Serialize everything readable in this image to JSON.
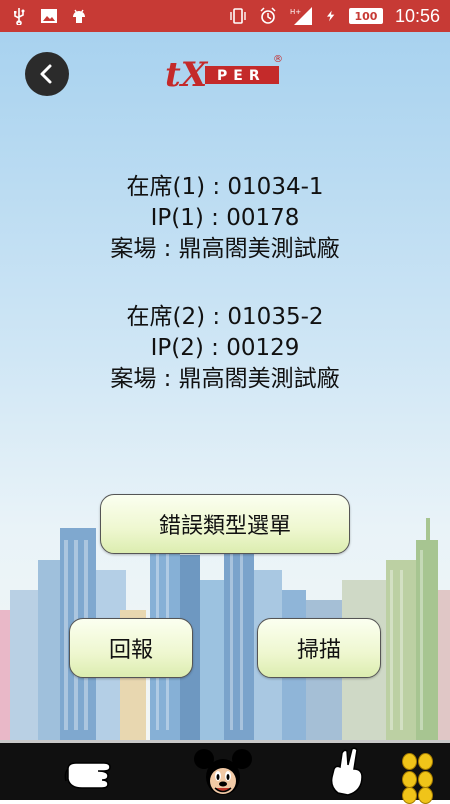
{
  "status_bar": {
    "time": "10:56",
    "battery": "100",
    "network": "H+",
    "icons_left": [
      "usb-icon",
      "image-icon",
      "android-icon"
    ],
    "icons_right": [
      "vibrate-icon",
      "alarm-icon",
      "signal-icon",
      "charging-icon",
      "battery-icon"
    ],
    "bg_color": "#c73a35"
  },
  "header": {
    "back_icon": "chevron-left-icon",
    "logo_text_tx": "tX",
    "logo_text_per": "PER",
    "logo_mark": "®"
  },
  "seat_1": {
    "seat": "在席(1) : 01034-1",
    "ip": "IP(1) : 00178",
    "site": "案場 : 鼎高閤美測試廠"
  },
  "seat_2": {
    "seat": "在席(2) : 01035-2",
    "ip": "IP(2) : 00129",
    "site": "案場 : 鼎高閤美測試廠"
  },
  "buttons": {
    "error_menu": "錯誤類型選單",
    "report": "回報",
    "scan": "掃描"
  },
  "bottom_bar": {
    "items": [
      "pointing-hand-icon",
      "mickey-mouse-icon",
      "peace-hand-icon",
      "coins-icon"
    ]
  }
}
